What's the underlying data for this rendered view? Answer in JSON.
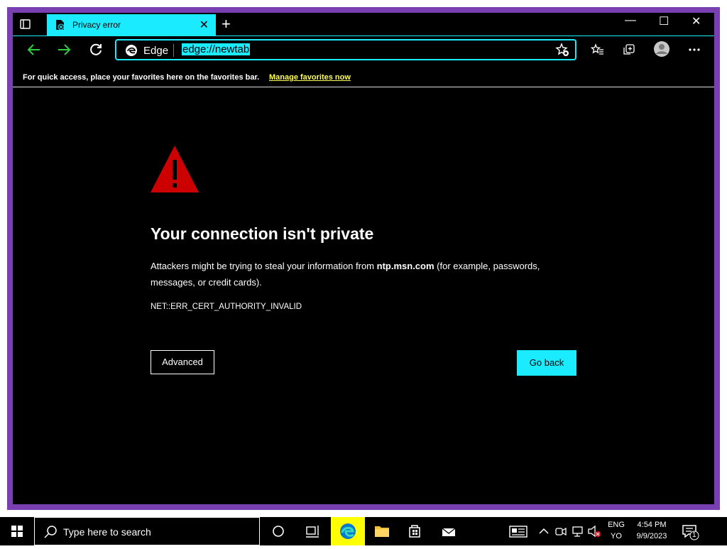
{
  "tab": {
    "title": "Privacy error",
    "close": "✕"
  },
  "window_controls": {
    "minimize": "—",
    "maximize": "☐",
    "close": "✕"
  },
  "new_tab": "+",
  "address": {
    "site_label": "Edge",
    "url": "edge://newtab"
  },
  "favorites_bar": {
    "message": "For quick access, place your favorites here on the favorites bar.",
    "link": "Manage favorites now"
  },
  "error": {
    "heading": "Your connection isn't private",
    "desc_before": "Attackers might be trying to steal your information from ",
    "host": "ntp.msn.com",
    "desc_after": " (for example, passwords, messages, or credit cards).",
    "code": "NET::ERR_CERT_AUTHORITY_INVALID",
    "advanced_label": "Advanced",
    "go_back_label": "Go back"
  },
  "taskbar": {
    "search_placeholder": "Type here to search",
    "lang_top": "ENG",
    "lang_bottom": "YO",
    "time": "4:54 PM",
    "date": "9/9/2023",
    "notifications": "1"
  },
  "colors": {
    "accent": "#1aebff",
    "frame": "#7a3fb0",
    "warning": "#cc0000",
    "link": "#ffff55"
  }
}
